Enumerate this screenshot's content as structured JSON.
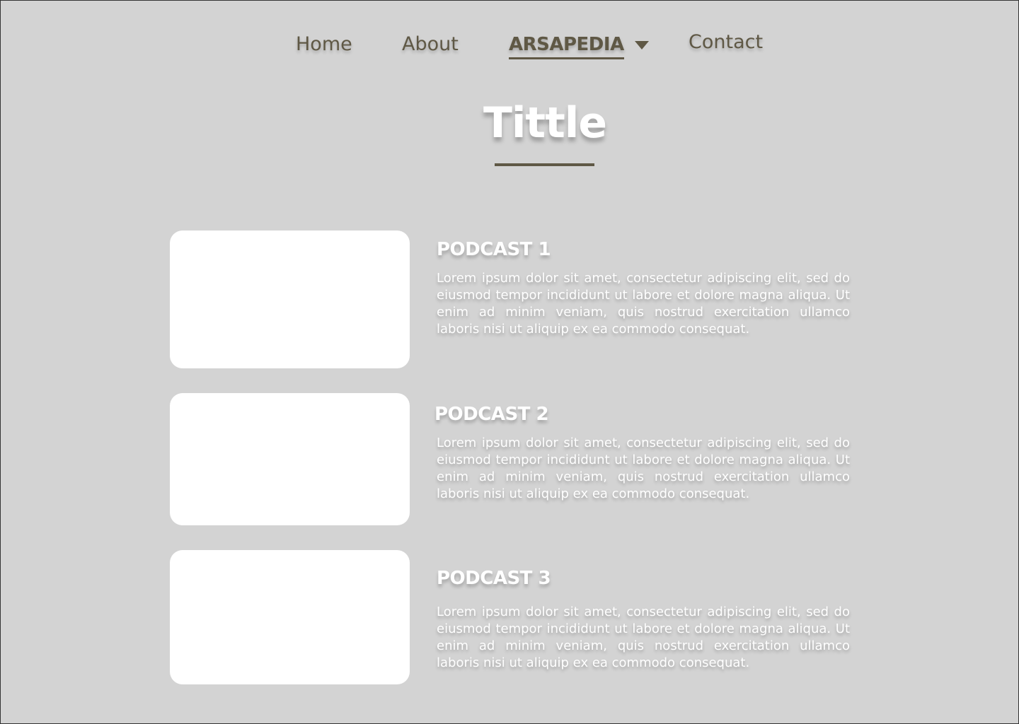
{
  "nav": {
    "items": [
      {
        "label": "Home"
      },
      {
        "label": "About"
      },
      {
        "label": "ARSAPEDIA"
      },
      {
        "label": "Contact"
      }
    ],
    "dropdown_icon": "caret-down-icon",
    "active": "ARSAPEDIA"
  },
  "page": {
    "title": "Tittle"
  },
  "podcasts": [
    {
      "title": "PODCAST 1",
      "description": "Lorem ipsum dolor sit amet, consectetur adipiscing elit, sed do eiusmod tempor incididunt ut labore et dolore magna aliqua. Ut enim ad minim veniam, quis nostrud exercitation ullamco laboris nisi ut aliquip ex ea commodo consequat."
    },
    {
      "title": "PODCAST 2",
      "description": "Lorem ipsum dolor sit amet, consectetur adipiscing elit, sed do eiusmod tempor incididunt ut labore et dolore magna aliqua. Ut enim ad minim veniam, quis nostrud exercitation ullamco laboris nisi ut aliquip ex ea commodo consequat."
    },
    {
      "title": "PODCAST 3",
      "description": "Lorem ipsum dolor sit amet, consectetur adipiscing elit, sed do eiusmod tempor incididunt ut labore et dolore magna aliqua. Ut enim ad minim veniam, quis nostrud exercitation ullamco laboris nisi ut aliquip ex ea commodo consequat."
    }
  ],
  "colors": {
    "background": "#d3d3d3",
    "accent": "#5f5845",
    "card": "#ffffff"
  }
}
